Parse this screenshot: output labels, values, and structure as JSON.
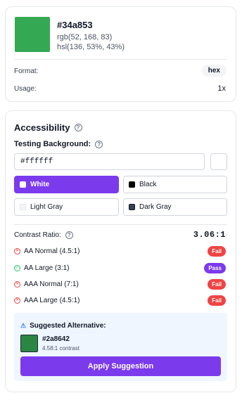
{
  "color": {
    "hex": "#34a853",
    "rgb": "rgb(52, 168, 83)",
    "hsl": "hsl(136, 53%, 43%)",
    "swatch_color": "#34a853"
  },
  "meta": {
    "format_label": "Format:",
    "format_value": "hex",
    "usage_label": "Usage:",
    "usage_value": "1x"
  },
  "accessibility": {
    "title": "Accessibility",
    "testing_bg_label": "Testing Background:",
    "testing_bg_value": "#ffffff",
    "options": [
      {
        "label": "White",
        "selected": true
      },
      {
        "label": "Black",
        "selected": false
      },
      {
        "label": "Light Gray",
        "selected": false
      },
      {
        "label": "Dark Gray",
        "selected": false
      }
    ],
    "contrast_label": "Contrast Ratio:",
    "contrast_value": "3.06:1",
    "checks": [
      {
        "label": "AA Normal (4.5:1)",
        "status": "Fail"
      },
      {
        "label": "AA Large (3:1)",
        "status": "Pass"
      },
      {
        "label": "AAA Normal (7:1)",
        "status": "Fail"
      },
      {
        "label": "AAA Large (4.5:1)",
        "status": "Fail"
      }
    ],
    "suggestion": {
      "title": "Suggested Alternative:",
      "hex": "#2a8642",
      "ratio": "4.58:1 contrast",
      "button": "Apply Suggestion"
    }
  },
  "colors": {
    "accent": "#7c3aed",
    "fail": "#ef4444",
    "pass_icon": "#22c55e",
    "info": "#3b82f6"
  }
}
